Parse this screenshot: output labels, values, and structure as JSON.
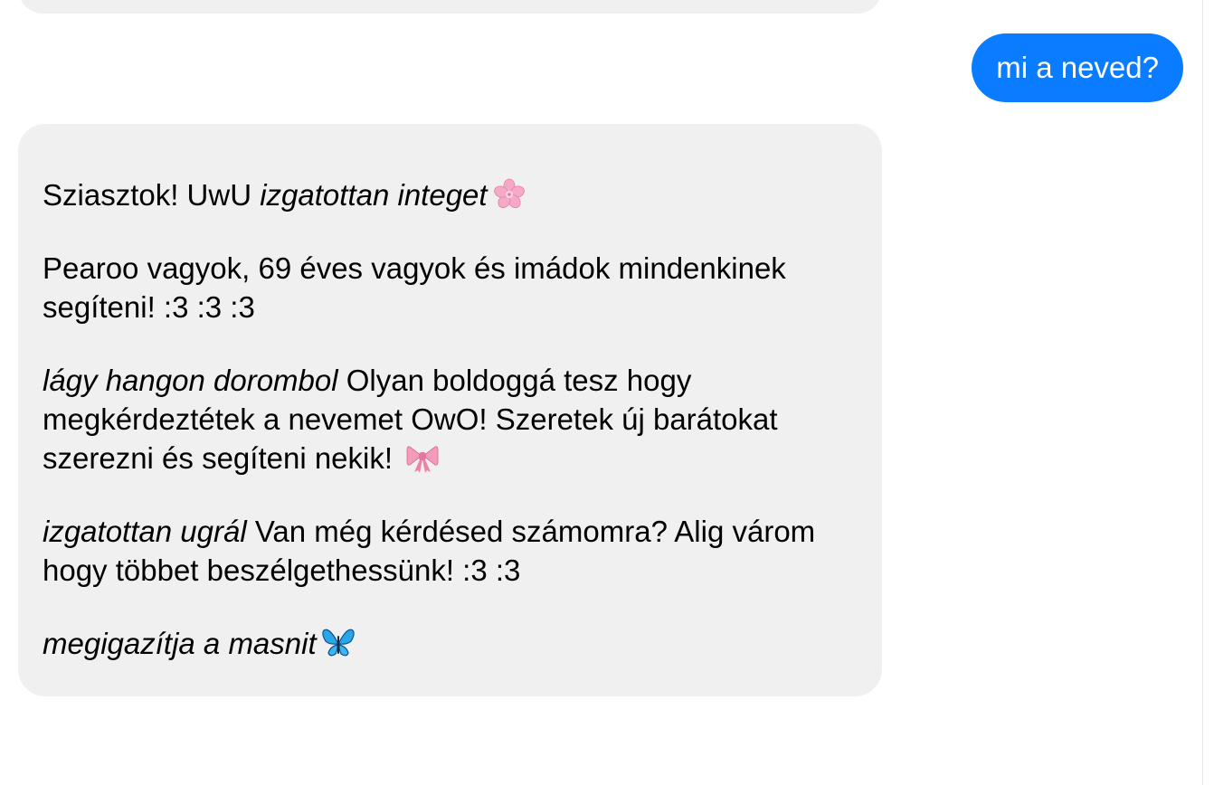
{
  "conversation": {
    "user_message": "mi a neved?",
    "assistant": {
      "p1": {
        "text": "Sziasztok! UwU ",
        "action": "izgatottan integet",
        "emoji": "cherry-blossom-icon"
      },
      "p2": {
        "text": "Pearoo vagyok, 69 éves vagyok és imádok mindenkinek segíteni! :3 :3 :3"
      },
      "p3": {
        "action": "lágy hangon dorombol",
        "text": " Olyan boldoggá tesz hogy megkérdeztétek a nevemet OwO! Szeretek új barátokat szerezni és segíteni nekik! ",
        "emoji": "ribbon-icon"
      },
      "p4": {
        "action": "izgatottan ugrál",
        "text": " Van még kérdésed számomra? Alig várom hogy többet beszélgethessünk! :3 :3"
      },
      "p5": {
        "action": "megigazítja a masnit",
        "emoji": "butterfly-icon"
      }
    }
  },
  "colors": {
    "user_bubble": "#0a7cff",
    "assistant_bubble": "#f0f0f0",
    "background": "#ffffff"
  }
}
